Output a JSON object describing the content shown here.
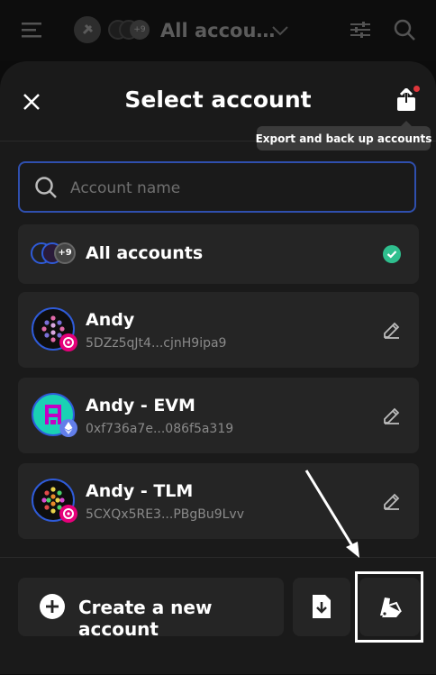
{
  "topbar": {
    "title": "All accou…",
    "plus_count": "+9"
  },
  "dialog": {
    "title": "Select account",
    "tooltip": "Export and back up accounts"
  },
  "search": {
    "placeholder": "Account name"
  },
  "accounts": [
    {
      "name": "All accounts",
      "plus_count": "+9"
    },
    {
      "name": "Andy",
      "address": "5DZz5qJt4...cjnH9ipa9"
    },
    {
      "name": "Andy - EVM",
      "address": "0xf736a7e...086f5a319"
    },
    {
      "name": "Andy - TLM",
      "address": "5CXQx5RE3...PBgBu9Lvv"
    }
  ],
  "footer": {
    "create_label": "Create a new account"
  },
  "colors": {
    "accent": "#2f5bd8",
    "check": "#2fbf8e",
    "polkadot": "#e6007a",
    "ethereum": "#627eea"
  }
}
